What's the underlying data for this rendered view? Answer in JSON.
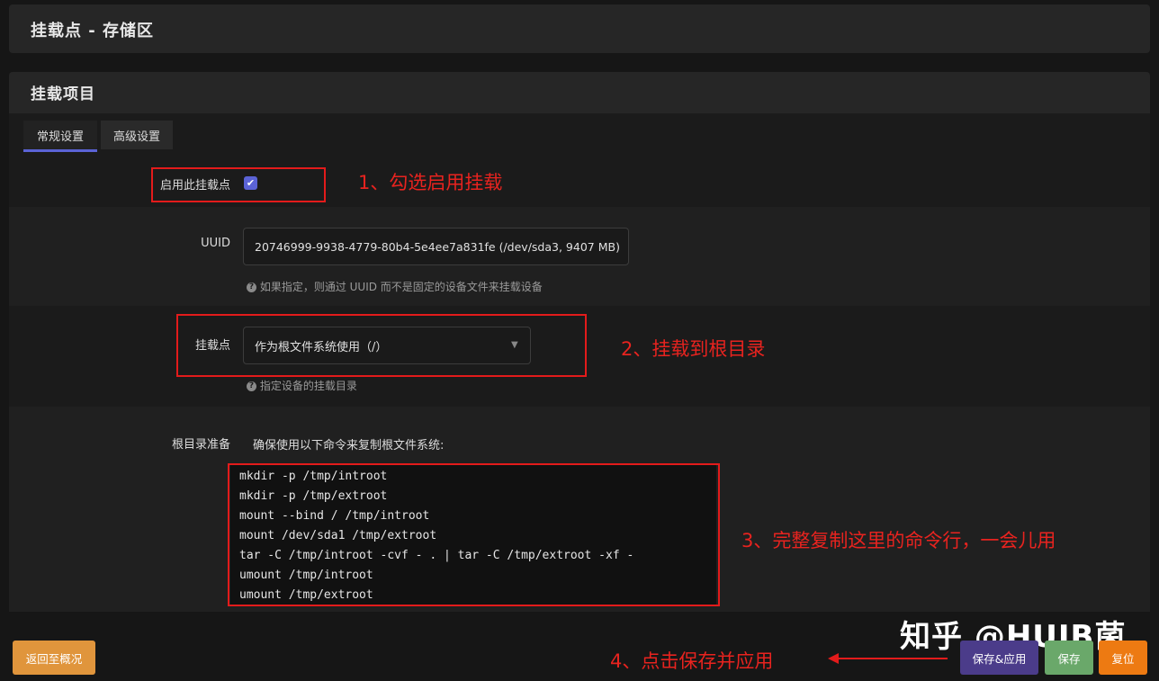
{
  "page": {
    "title": "挂载点 - 存储区",
    "section_title": "挂载项目"
  },
  "tabs": [
    {
      "label": "常规设置",
      "active": true
    },
    {
      "label": "高级设置",
      "active": false
    }
  ],
  "form": {
    "enable": {
      "label": "启用此挂载点",
      "checked": true,
      "check_glyph": "✔"
    },
    "uuid": {
      "label": "UUID",
      "value": "20746999-9938-4779-80b4-5e4ee7a831fe (/dev/sda3, 9407 MB)",
      "hint": "如果指定，则通过 UUID 而不是固定的设备文件来挂载设备"
    },
    "mountpoint": {
      "label": "挂载点",
      "selected": "作为根文件系统使用（/）",
      "hint": "指定设备的挂载目录"
    },
    "rootprep": {
      "label": "根目录准备",
      "intro": "确保使用以下命令来复制根文件系统:",
      "commands": [
        "mkdir -p /tmp/introot",
        "mkdir -p /tmp/extroot",
        "mount --bind / /tmp/introot",
        "mount /dev/sda1 /tmp/extroot",
        "tar -C /tmp/introot -cvf - . | tar -C /tmp/extroot -xf -",
        "umount /tmp/introot",
        "umount /tmp/extroot"
      ]
    }
  },
  "hint_icon_glyph": "?",
  "buttons": {
    "back": "返回至概况",
    "save_apply": "保存&应用",
    "save": "保存",
    "reset": "复位"
  },
  "annotations": {
    "step1": "1、勾选启用挂载",
    "step2": "2、挂载到根目录",
    "step3": "3、完整复制这里的命令行，一会儿用",
    "step4": "4、点击保存并应用"
  },
  "watermark": "知乎 @HUIB菌",
  "colors": {
    "accent": "#5b63d6",
    "annotation_red": "#e31b1b",
    "btn_back": "#e0953c",
    "btn_save_apply": "#4b3c8a",
    "btn_save": "#6aa86a",
    "btn_reset": "#ed7a12"
  }
}
